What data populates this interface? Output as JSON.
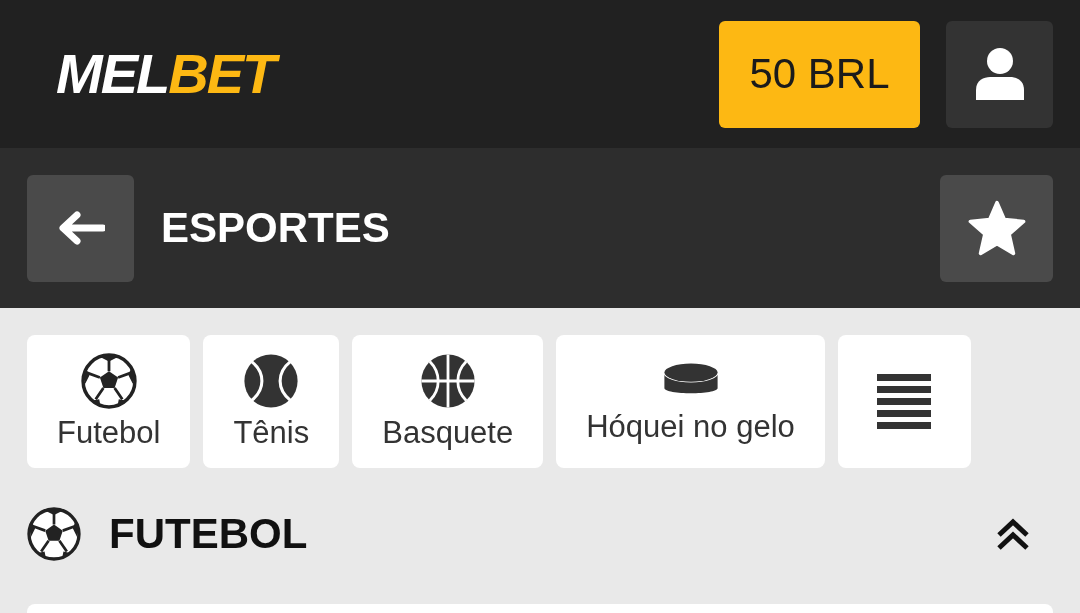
{
  "header": {
    "logo": "MEL**BET**",
    "balance_button": "50 BRL"
  },
  "title_bar": {
    "title": "ESPORTES"
  },
  "sports": [
    {
      "kind": "soccer",
      "label": "Futebol"
    },
    {
      "kind": "tennis",
      "label": "Tênis"
    },
    {
      "kind": "basketball",
      "label": "Basquete"
    },
    {
      "kind": "puck",
      "label": "Hóquei no gelo"
    },
    {
      "kind": "menu"
    }
  ],
  "section": {
    "title": "FUTEBOL",
    "expanded": true
  }
}
